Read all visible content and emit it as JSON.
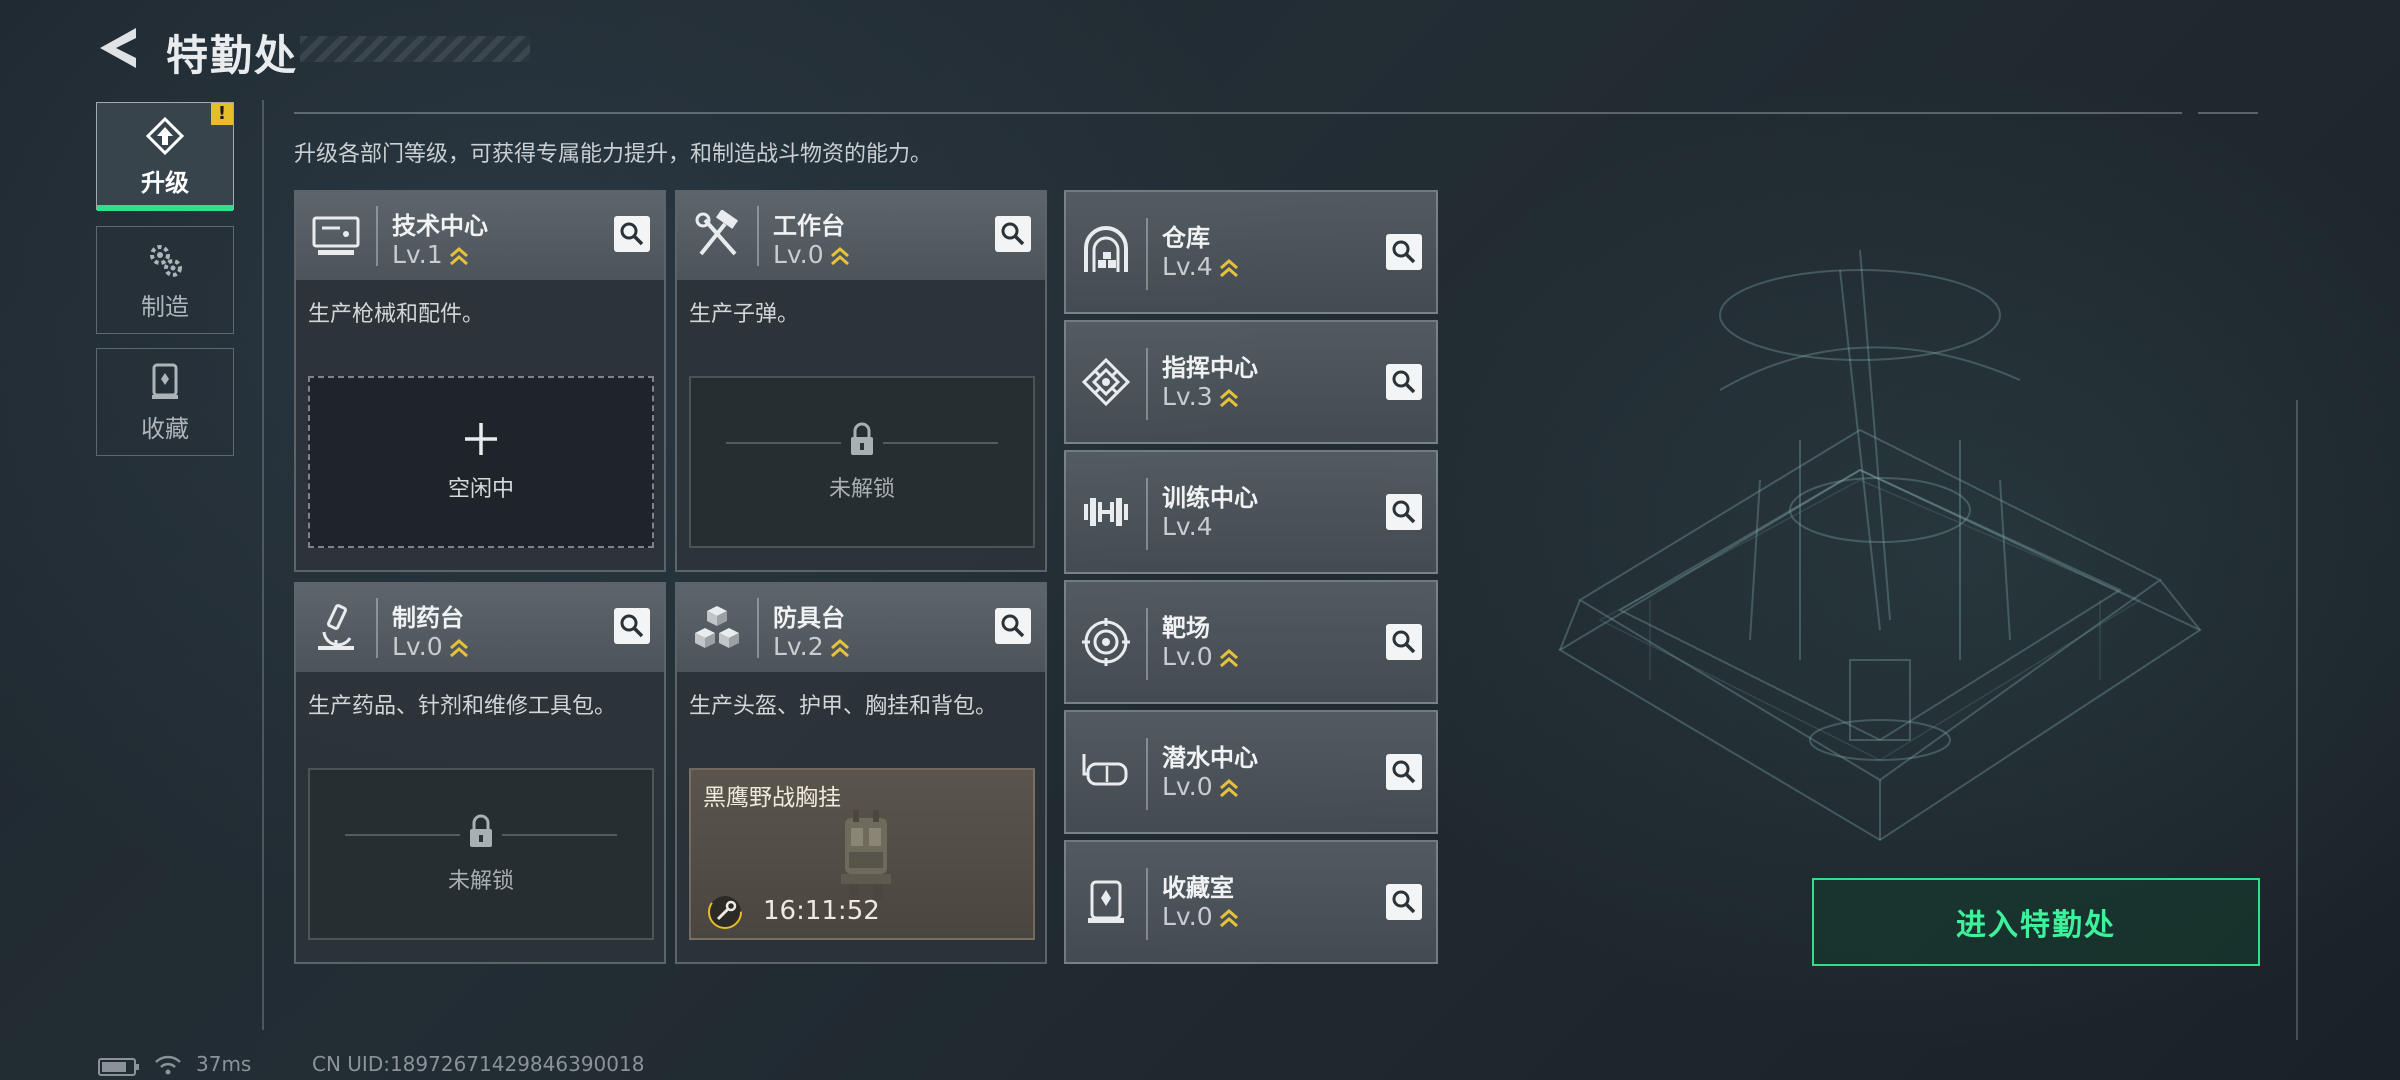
{
  "header": {
    "title": "特勤处"
  },
  "sidebar": {
    "tabs": [
      {
        "label": "升级",
        "icon": "upgrade-icon",
        "active": true,
        "badge": "!"
      },
      {
        "label": "制造",
        "icon": "gears-icon",
        "active": false
      },
      {
        "label": "收藏",
        "icon": "collection-icon",
        "active": false
      }
    ]
  },
  "main": {
    "description": "升级各部门等级，可获得专属能力提升，和制造战斗物资的能力。",
    "big_cards": [
      {
        "name": "技术中心",
        "level": "Lv.1",
        "icon": "computer-icon",
        "text": "生产枪械和配件。",
        "slot": {
          "type": "idle",
          "label": "空闲中"
        }
      },
      {
        "name": "工作台",
        "level": "Lv.0",
        "icon": "tools-icon",
        "text": "生产子弹。",
        "slot": {
          "type": "locked",
          "label": "未解锁"
        }
      },
      {
        "name": "制药台",
        "level": "Lv.0",
        "icon": "microscope-icon",
        "text": "生产药品、针剂和维修工具包。",
        "slot": {
          "type": "locked",
          "label": "未解锁"
        }
      },
      {
        "name": "防具台",
        "level": "Lv.2",
        "icon": "armor-boxes-icon",
        "text": "生产头盔、护甲、胸挂和背包。",
        "slot": {
          "type": "crafting",
          "item": "黑鹰野战胸挂",
          "time": "16:11:52"
        }
      }
    ],
    "small_cards": [
      {
        "name": "仓库",
        "level": "Lv.4",
        "icon": "warehouse-icon",
        "upgradable": true
      },
      {
        "name": "指挥中心",
        "level": "Lv.3",
        "icon": "command-icon",
        "upgradable": true
      },
      {
        "name": "训练中心",
        "level": "Lv.4",
        "icon": "dumbbell-icon",
        "upgradable": false
      },
      {
        "name": "靶场",
        "level": "Lv.0",
        "icon": "target-icon",
        "upgradable": true
      },
      {
        "name": "潜水中心",
        "level": "Lv.0",
        "icon": "diving-mask-icon",
        "upgradable": true
      },
      {
        "name": "收藏室",
        "level": "Lv.0",
        "icon": "collection-room-icon",
        "upgradable": true
      }
    ]
  },
  "enter_button": {
    "label": "进入特勤处"
  },
  "status_bar": {
    "ping": "37ms",
    "uid": "CN UID:18972671429846390018"
  },
  "colors": {
    "accent_green": "#2ee08a",
    "badge_yellow": "#e6bd2a",
    "upgrade_chevron": "#e8c13a"
  }
}
